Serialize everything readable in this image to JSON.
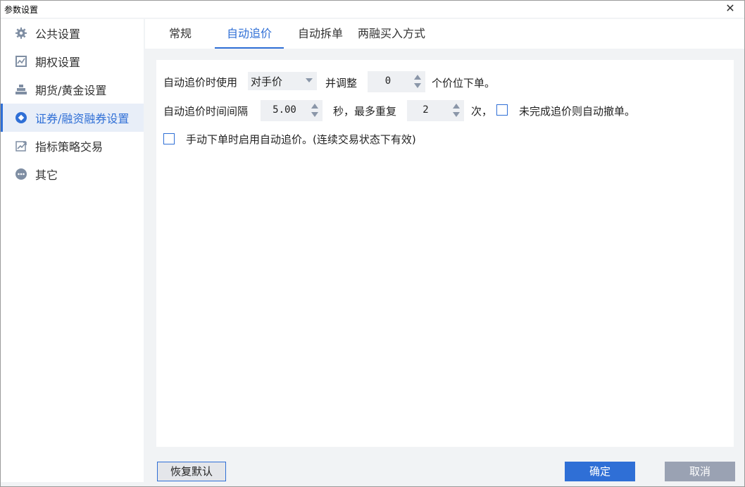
{
  "window": {
    "title": "参数设置",
    "close_glyph": "✕"
  },
  "sidebar": {
    "items": [
      {
        "label": "公共设置",
        "icon": "gear-icon",
        "active": false
      },
      {
        "label": "期权设置",
        "icon": "chart-icon",
        "active": false
      },
      {
        "label": "期货/黄金设置",
        "icon": "bars-icon",
        "active": false
      },
      {
        "label": "证券/融资融券设置",
        "icon": "diamond-icon",
        "active": true
      },
      {
        "label": "指标策略交易",
        "icon": "trend-icon",
        "active": false
      },
      {
        "label": "其它",
        "icon": "more-icon",
        "active": false
      }
    ]
  },
  "tabs": [
    {
      "label": "常规",
      "active": false
    },
    {
      "label": "自动追价",
      "active": true
    },
    {
      "label": "自动拆单",
      "active": false
    },
    {
      "label": "两融买入方式",
      "active": false
    }
  ],
  "form": {
    "row1": {
      "label_use": "自动追价时使用",
      "price_type": "对手价",
      "label_adjust": "并调整",
      "adjust_ticks": "0",
      "label_suffix": "个价位下单。"
    },
    "row2": {
      "label_interval": "自动追价时间间隔",
      "interval": "5.00",
      "label_sec": "秒，最多重复",
      "repeat": "2",
      "label_times": "次，",
      "cancel_checked": false,
      "label_cancel": "未完成追价则自动撤单。"
    },
    "row3": {
      "manual_checked": false,
      "label_manual": "手动下单时启用自动追价。(连续交易状态下有效)"
    }
  },
  "footer": {
    "reset_label": "恢复默认",
    "ok_label": "确定",
    "cancel_label": "取消"
  },
  "colors": {
    "accent": "#2f6fd6",
    "cancel_button": "#9aa2b3",
    "background": "#f1f3f5"
  }
}
